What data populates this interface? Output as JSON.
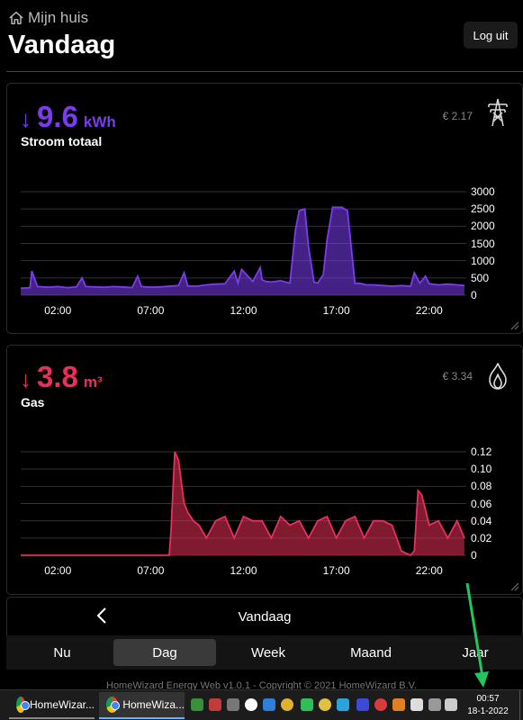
{
  "header": {
    "home_label": "Mijn huis",
    "title": "Vandaag",
    "logout_label": "Log uit"
  },
  "electricity": {
    "arrow": "↓",
    "value": "9.6",
    "unit": "kWh",
    "label": "Stroom totaal",
    "cost": "€ 2.17",
    "icon": "power-pylon-icon",
    "color": "#7b3cf0",
    "chart_data": {
      "type": "area",
      "ylim": [
        0,
        3000
      ],
      "yticks": [
        "3000",
        "2500",
        "2000",
        "1500",
        "1000",
        "500",
        "0"
      ],
      "xticks": [
        "02:00",
        "07:00",
        "12:00",
        "17:00",
        "22:00"
      ],
      "x_hours": [
        0,
        0.5,
        0.6,
        0.9,
        1.5,
        2.0,
        2.5,
        3.0,
        3.3,
        3.5,
        4.0,
        4.5,
        5.0,
        5.5,
        6.0,
        6.3,
        6.5,
        7.0,
        7.5,
        8.0,
        8.5,
        8.8,
        9.0,
        9.5,
        10.0,
        10.5,
        11.0,
        11.5,
        11.7,
        11.9,
        12.5,
        12.9,
        13.0,
        13.2,
        13.5,
        14.0,
        14.5,
        14.8,
        15.0,
        15.3,
        15.5,
        15.8,
        16.0,
        16.3,
        16.5,
        16.8,
        17.0,
        17.3,
        17.6,
        18.0,
        18.4,
        18.6,
        19.0,
        19.5,
        20.0,
        20.5,
        21.0,
        21.2,
        21.5,
        21.8,
        22.0,
        22.5,
        23.0,
        23.5,
        23.9
      ],
      "values": [
        200,
        220,
        700,
        250,
        230,
        250,
        220,
        240,
        500,
        250,
        240,
        230,
        250,
        240,
        220,
        550,
        250,
        230,
        240,
        260,
        280,
        650,
        270,
        260,
        300,
        320,
        330,
        700,
        350,
        750,
        400,
        800,
        450,
        400,
        380,
        420,
        350,
        1900,
        2450,
        2500,
        1400,
        380,
        350,
        600,
        1600,
        2550,
        2550,
        2550,
        2450,
        350,
        330,
        300,
        300,
        280,
        260,
        280,
        260,
        650,
        350,
        550,
        330,
        300,
        320,
        300,
        280
      ]
    }
  },
  "gas": {
    "arrow": "↓",
    "value": "3.8",
    "unit": "m³",
    "label": "Gas",
    "cost": "€ 3.34",
    "icon": "flame-icon",
    "color": "#e8305a",
    "chart_data": {
      "type": "area",
      "ylim": [
        0,
        0.12
      ],
      "yticks": [
        "0.12",
        "0.10",
        "0.08",
        "0.06",
        "0.04",
        "0.02",
        "0"
      ],
      "xticks": [
        "02:00",
        "07:00",
        "12:00",
        "17:00",
        "22:00"
      ],
      "x_hours": [
        0,
        8.0,
        8.1,
        8.3,
        8.5,
        8.8,
        9.0,
        9.3,
        9.6,
        10.0,
        10.5,
        11.0,
        11.5,
        12.0,
        12.5,
        13.0,
        13.5,
        14.0,
        14.5,
        15.0,
        15.5,
        16.0,
        16.5,
        17.0,
        17.5,
        18.0,
        18.5,
        19.0,
        19.5,
        20.0,
        20.5,
        21.0,
        21.2,
        21.4,
        21.6,
        22.0,
        22.5,
        23.0,
        23.5,
        23.9
      ],
      "values": [
        0,
        0,
        0.03,
        0.12,
        0.11,
        0.06,
        0.05,
        0.04,
        0.035,
        0.02,
        0.04,
        0.045,
        0.02,
        0.045,
        0.04,
        0.04,
        0.02,
        0.045,
        0.035,
        0.04,
        0.02,
        0.04,
        0.045,
        0.02,
        0.04,
        0.045,
        0.02,
        0.04,
        0.04,
        0.035,
        0.005,
        0.0,
        0.005,
        0.075,
        0.07,
        0.035,
        0.04,
        0.02,
        0.04,
        0.02
      ]
    }
  },
  "navigation": {
    "period": "Vandaag",
    "tabs": [
      "Nu",
      "Dag",
      "Week",
      "Maand",
      "Jaar"
    ],
    "active_tab": "Dag"
  },
  "footer": {
    "text": "HomeWizard Energy Web v1.0.1 - Copyright © 2021 HomeWizard B.V."
  },
  "taskbar": {
    "tasks": [
      "HomeWizar...",
      "HomeWiza..."
    ],
    "time": "00:57",
    "date": "18-1-2022"
  },
  "annotation": {
    "arrow_color": "#22c55e"
  }
}
